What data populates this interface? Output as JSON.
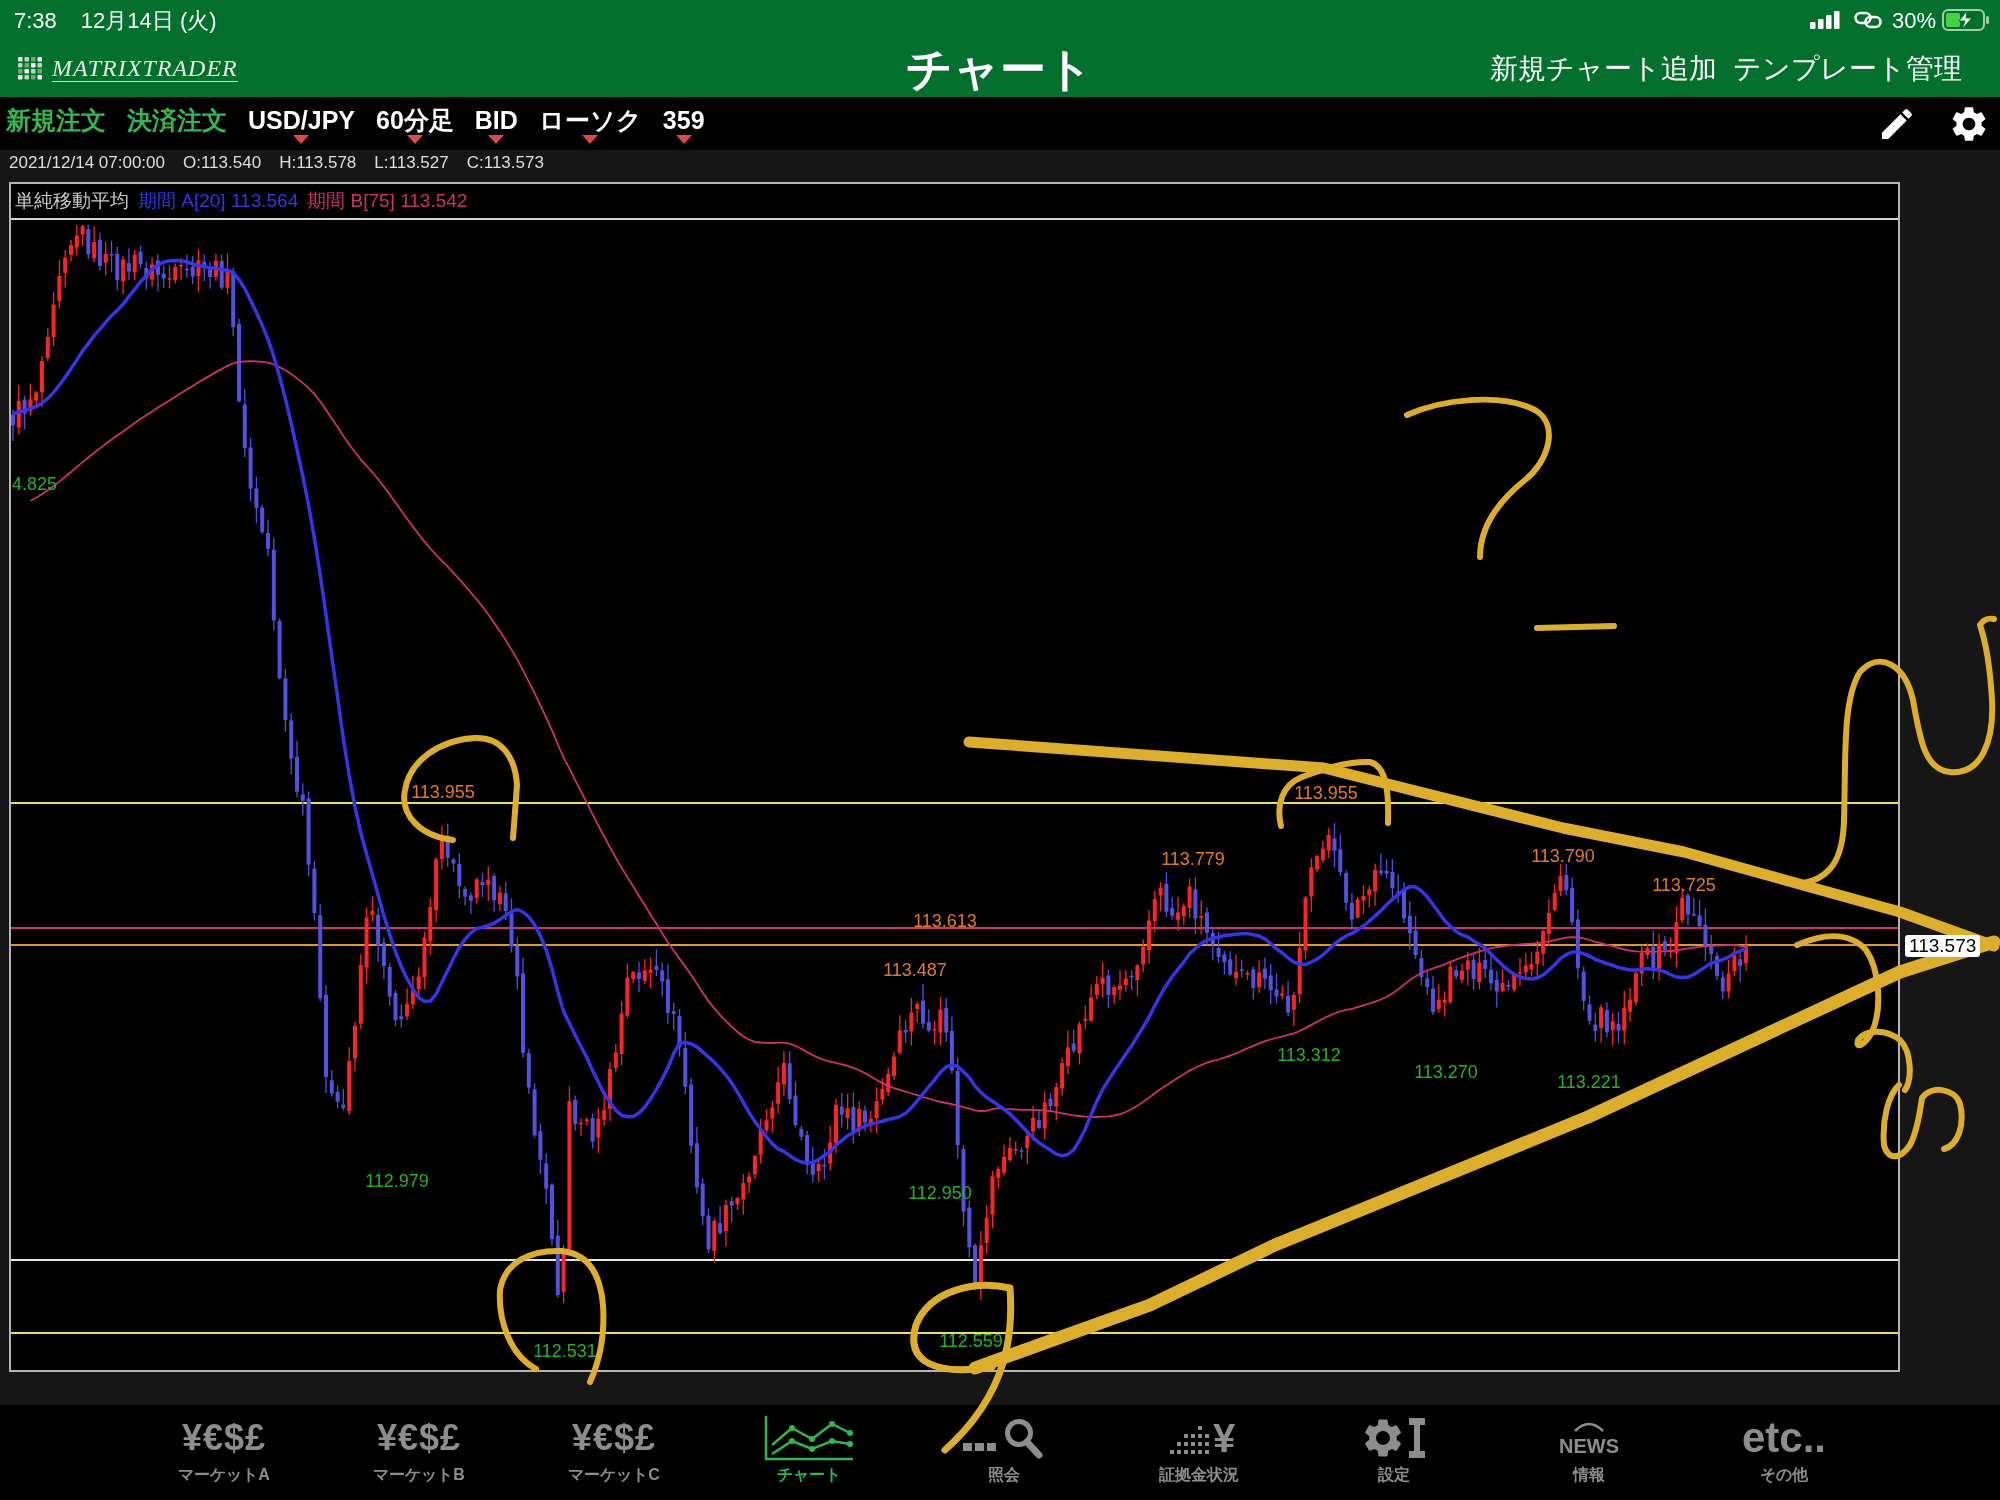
{
  "status_bar": {
    "time": "7:38",
    "date": "12月14日 (火)",
    "battery_percent": "30%"
  },
  "header": {
    "logo": "MATRIXTRADER",
    "title": "チャート",
    "actions": [
      "新規チャート追加",
      "テンプレート管理"
    ]
  },
  "toolbar": {
    "order_buttons": [
      "新規注文",
      "決済注文"
    ],
    "selectors": [
      "USD/JPY",
      "60分足",
      "BID",
      "ローソク",
      "359"
    ]
  },
  "ohlc": {
    "datetime": "2021/12/14 07:00:00",
    "values": [
      "O:113.540",
      "H:113.578",
      "L:113.527",
      "C:113.573"
    ]
  },
  "chart": {
    "legend": {
      "title": "単純移動平均",
      "series": [
        {
          "label": "期間 A[20] 113.564",
          "color": "#3535ea"
        },
        {
          "label": "期間 B[75] 113.542",
          "color": "#d02f72"
        }
      ]
    },
    "price_labels": [
      {
        "text": "4.825",
        "kind": "low"
      },
      {
        "text": "113.955",
        "kind": "high"
      },
      {
        "text": "112.979",
        "kind": "low"
      },
      {
        "text": "112.531",
        "kind": "low"
      },
      {
        "text": "113.613",
        "kind": "high"
      },
      {
        "text": "113.487",
        "kind": "high"
      },
      {
        "text": "112.950",
        "kind": "low"
      },
      {
        "text": "112.559",
        "kind": "low"
      },
      {
        "text": "113.779",
        "kind": "high"
      },
      {
        "text": "113.955",
        "kind": "high"
      },
      {
        "text": "113.312",
        "kind": "low"
      },
      {
        "text": "113.270",
        "kind": "low"
      },
      {
        "text": "113.790",
        "kind": "high"
      },
      {
        "text": "113.221",
        "kind": "low"
      },
      {
        "text": "113.725",
        "kind": "high"
      }
    ],
    "current_price": "113.573"
  },
  "tabs": [
    {
      "kind": "currency",
      "symbol": "¥€$£",
      "label": "マーケットA",
      "selected": false
    },
    {
      "kind": "currency",
      "symbol": "¥€$£",
      "label": "マーケットB",
      "selected": false
    },
    {
      "kind": "currency",
      "symbol": "¥€$£",
      "label": "マーケットC",
      "selected": false
    },
    {
      "kind": "chart",
      "label": "チャート",
      "selected": true
    },
    {
      "kind": "search",
      "label": "照会",
      "selected": false
    },
    {
      "kind": "margin",
      "symbol": "¥",
      "label": "証拠金状況",
      "selected": false
    },
    {
      "kind": "tools",
      "label": "設定",
      "selected": false
    },
    {
      "kind": "news",
      "symbol": "NEWS",
      "label": "情報",
      "selected": false
    },
    {
      "kind": "text",
      "symbol": "etc..",
      "label": "その他",
      "selected": false
    }
  ]
}
